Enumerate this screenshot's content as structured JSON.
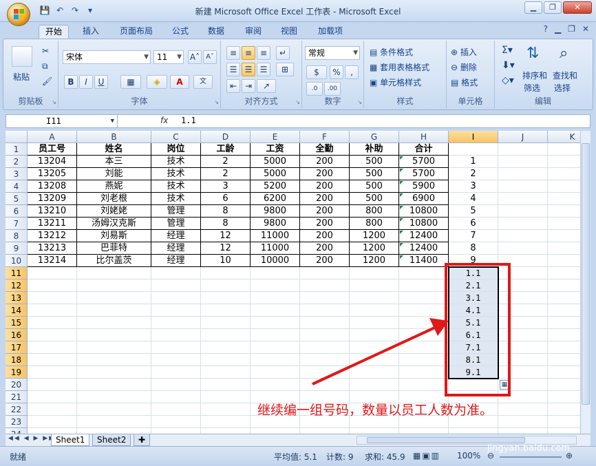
{
  "window": {
    "title": "新建 Microsoft Office Excel 工作表 - Microsoft Excel"
  },
  "tabs": [
    "开始",
    "插入",
    "页面布局",
    "公式",
    "数据",
    "审阅",
    "视图",
    "加载项"
  ],
  "ribbon": {
    "paste": "粘贴",
    "groups": [
      "剪贴板",
      "字体",
      "对齐方式",
      "数字",
      "样式",
      "单元格",
      "编辑"
    ],
    "font_name": "宋体",
    "font_size": "11",
    "number_format": "常规",
    "styles": [
      "条件格式",
      "套用表格格式",
      "单元格样式"
    ],
    "cells": [
      "插入",
      "删除",
      "格式"
    ],
    "edit": [
      "排序和",
      "筛选",
      "查找和",
      "选择"
    ],
    "bold": "B",
    "italic": "I",
    "underline": "U"
  },
  "formula_bar": {
    "name_box": "I11",
    "fx": "fx",
    "value": "1.1"
  },
  "columns": [
    "A",
    "B",
    "C",
    "D",
    "E",
    "F",
    "G",
    "H",
    "I",
    "J",
    "K"
  ],
  "header_row": [
    "员工号",
    "姓名",
    "岗位",
    "工龄",
    "工资",
    "全勤",
    "补助",
    "合计"
  ],
  "employees": [
    [
      "13204",
      "本三",
      "技术",
      "2",
      "5000",
      "200",
      "500",
      "5700",
      "1"
    ],
    [
      "13205",
      "刘能",
      "技术",
      "2",
      "5000",
      "200",
      "500",
      "5700",
      "2"
    ],
    [
      "13208",
      "燕妮",
      "技术",
      "3",
      "5200",
      "200",
      "500",
      "5900",
      "3"
    ],
    [
      "13209",
      "刘老根",
      "技术",
      "6",
      "6200",
      "200",
      "500",
      "6900",
      "4"
    ],
    [
      "13210",
      "刘姥姥",
      "管理",
      "8",
      "9800",
      "200",
      "800",
      "10800",
      "5"
    ],
    [
      "13211",
      "汤姆汉克斯",
      "管理",
      "8",
      "9800",
      "200",
      "800",
      "10800",
      "6"
    ],
    [
      "13212",
      "刘易斯",
      "经理",
      "12",
      "11000",
      "200",
      "1200",
      "12400",
      "7"
    ],
    [
      "13213",
      "巴菲特",
      "经理",
      "12",
      "11000",
      "200",
      "1200",
      "12400",
      "8"
    ],
    [
      "13214",
      "比尔盖茨",
      "经理",
      "10",
      "10000",
      "200",
      "1200",
      "11400",
      "9"
    ]
  ],
  "fill_values": [
    "1.1",
    "2.1",
    "3.1",
    "4.1",
    "5.1",
    "6.1",
    "7.1",
    "8.1",
    "9.1"
  ],
  "row_numbers": [
    "1",
    "2",
    "3",
    "4",
    "5",
    "6",
    "7",
    "8",
    "9",
    "10",
    "11",
    "12",
    "13",
    "14",
    "15",
    "16",
    "17",
    "18",
    "19",
    "20",
    "21",
    "22",
    "23",
    "24"
  ],
  "sheets": [
    "Sheet1",
    "Sheet2"
  ],
  "status": {
    "ready": "就绪",
    "average": "平均值: 5.1",
    "count": "计数: 9",
    "sum": "求和: 45.9",
    "zoom": "100%"
  },
  "annotation": "继续编一组号码，数量以员工人数为准。",
  "watermark": "jingyan.baidu.com",
  "colors": {
    "accent_red": "#e01818",
    "selection_header": "#f7c466"
  }
}
